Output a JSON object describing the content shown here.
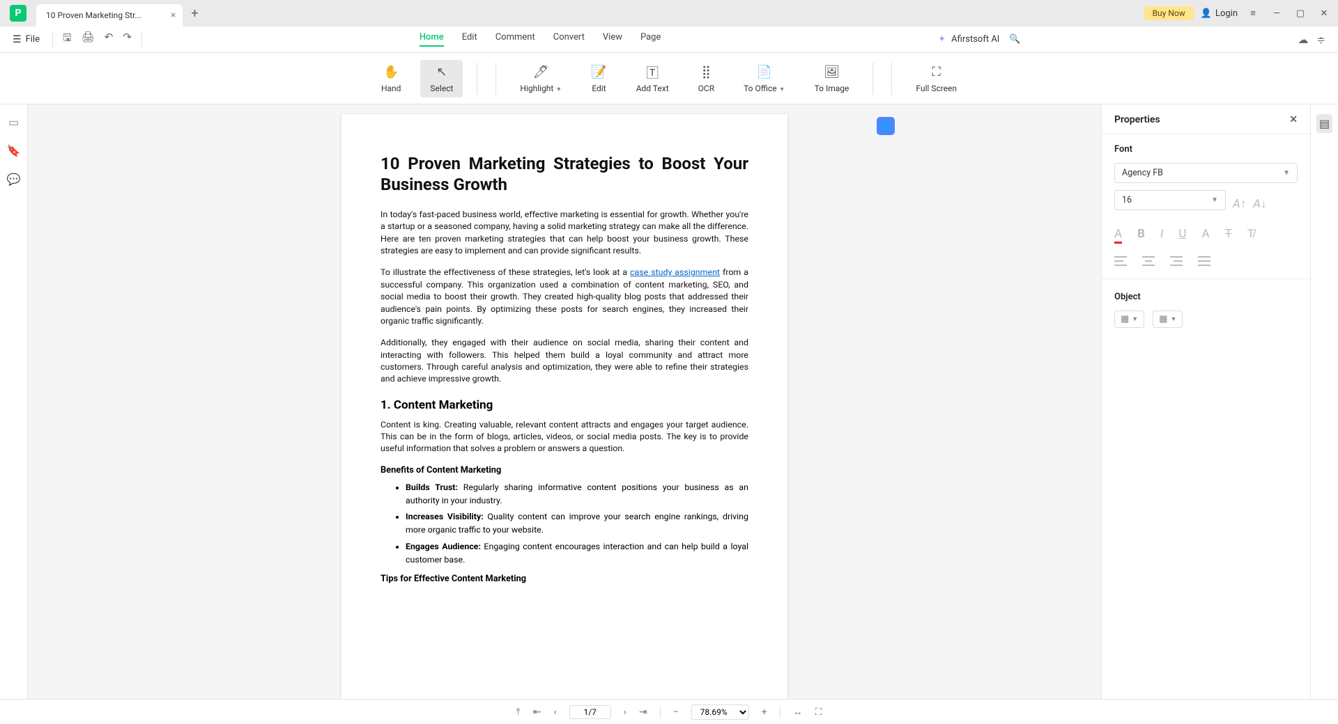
{
  "titlebar": {
    "tab_title": "10 Proven Marketing Str...",
    "buy_now": "Buy Now",
    "login": "Login"
  },
  "menubar": {
    "file": "File",
    "tabs": [
      "Home",
      "Edit",
      "Comment",
      "Convert",
      "View",
      "Page"
    ],
    "active_index": 0,
    "ai_label": "Afirstsoft AI"
  },
  "ribbon": {
    "items": [
      {
        "label": "Hand",
        "icon": "✋"
      },
      {
        "label": "Select",
        "icon": "↖",
        "selected": true
      },
      {
        "label": "Highlight",
        "icon": "🖊",
        "dropdown": true
      },
      {
        "label": "Edit",
        "icon": "📝"
      },
      {
        "label": "Add Text",
        "icon": "🅃"
      },
      {
        "label": "OCR",
        "icon": "⣿"
      },
      {
        "label": "To Office",
        "icon": "📄",
        "dropdown": true
      },
      {
        "label": "To Image",
        "icon": "🖼"
      },
      {
        "label": "Full Screen",
        "icon": "⛶"
      }
    ]
  },
  "document": {
    "title": "10 Proven Marketing Strategies to Boost Your Business Growth",
    "p1": "In today's fast-paced business world, effective marketing is essential for growth. Whether you're a startup or a seasoned company, having a solid marketing strategy can make all the difference. Here are ten proven marketing strategies that can help boost your business growth. These strategies are easy to implement and can provide significant results.",
    "p2a": "To illustrate the effectiveness of these strategies, let's look at a ",
    "p2_link": "case study assignment",
    "p2b": " from a successful company. This organization used a combination of content marketing, SEO, and social media to boost their growth. They created high-quality blog posts that addressed their audience's pain points. By optimizing these posts for search engines, they increased their organic traffic significantly.",
    "p3": "Additionally, they engaged with their audience on social media, sharing their content and interacting with followers. This helped them build a loyal community and attract more customers. Through careful analysis and optimization, they were able to refine their strategies and achieve impressive growth.",
    "h2_1": "1. Content Marketing",
    "p4": "Content is king. Creating valuable, relevant content attracts and engages your target audience. This can be in the form of blogs, articles, videos, or social media posts. The key is to provide useful information that solves a problem or answers a question.",
    "sub1": "Benefits of Content Marketing",
    "bullets": [
      {
        "b": "Builds Trust:",
        "t": " Regularly sharing informative content positions your business as an authority in your industry."
      },
      {
        "b": "Increases Visibility:",
        "t": " Quality content can improve your search engine rankings, driving more organic traffic to your website."
      },
      {
        "b": "Engages Audience:",
        "t": " Engaging content encourages interaction and can help build a loyal customer base."
      }
    ],
    "sub2": "Tips for Effective Content Marketing"
  },
  "properties": {
    "title": "Properties",
    "font_section": "Font",
    "font_name": "Agency FB",
    "font_size": "16",
    "object_section": "Object"
  },
  "statusbar": {
    "page": "1/7",
    "zoom": "78.69%"
  }
}
